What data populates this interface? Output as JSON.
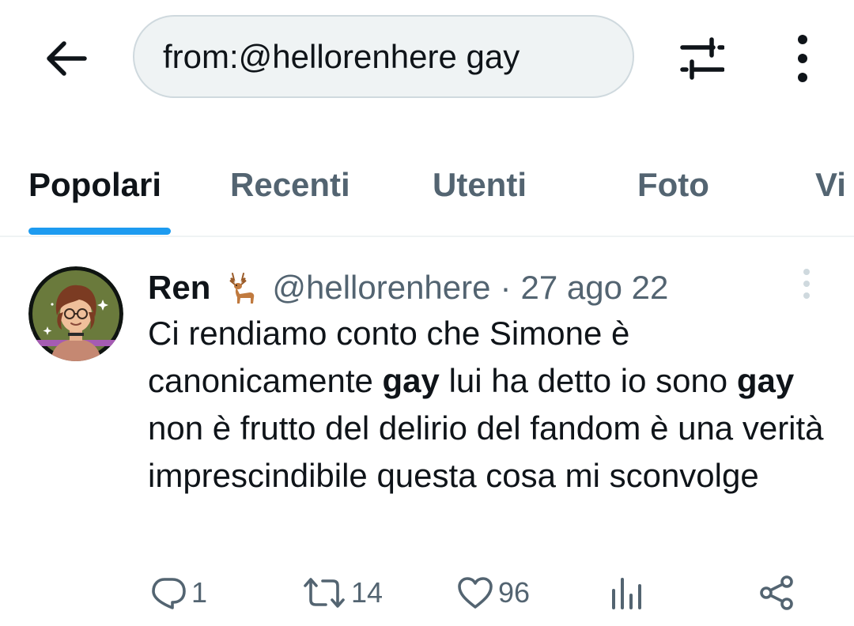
{
  "header": {
    "back_icon": "arrow-left-icon",
    "search_value": "from:@hellorenhere gay",
    "filter_icon": "sliders-icon",
    "more_icon": "more-vertical-icon"
  },
  "tabs": [
    {
      "label": "Popolari",
      "active": true
    },
    {
      "label": "Recenti",
      "active": false
    },
    {
      "label": "Utenti",
      "active": false
    },
    {
      "label": "Foto",
      "active": false
    },
    {
      "label": "Vi",
      "active": false
    }
  ],
  "tweet": {
    "author_name": "Ren",
    "name_emoji": "deer-icon",
    "handle": "@hellorenhere",
    "separator": "·",
    "time": "27 ago 22",
    "text_segments": [
      "Ci rendiamo conto che Simone è canonicamente ",
      "gay",
      " lui ha detto io sono ",
      "gay",
      " non è frutto del delirio del fandom è una verità imprescindibile questa cosa mi sconvolge"
    ],
    "actions": {
      "replies": "1",
      "retweets": "14",
      "likes": "96",
      "views_icon": "bar-chart-icon",
      "share_icon": "share-icon"
    }
  },
  "colors": {
    "accent": "#1d9bf0",
    "text_primary": "#0f1419",
    "text_secondary": "#536471",
    "search_bg": "#eff3f4",
    "divider": "#eff3f4"
  }
}
